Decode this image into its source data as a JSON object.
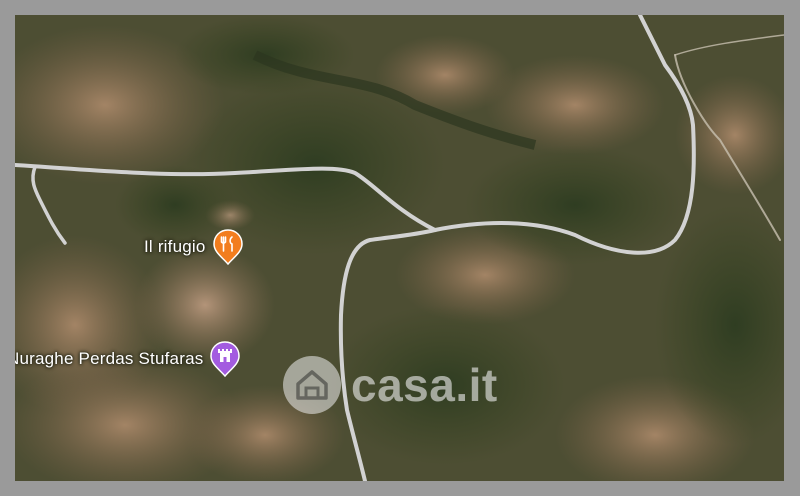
{
  "map": {
    "pois": [
      {
        "label": "Il rifugio",
        "icon": "restaurant-icon",
        "color": "#f27d1e"
      },
      {
        "label": "Nuraghe Perdas Stufaras",
        "icon": "landmark-icon",
        "color": "#a35be0"
      }
    ],
    "watermark": {
      "text": "casa.it",
      "icon": "house-icon"
    }
  },
  "colors": {
    "frame": "#9a9a9a",
    "road": "#d2d2d2",
    "forest": "#3f4a2c",
    "soil": "#8a6e52"
  }
}
